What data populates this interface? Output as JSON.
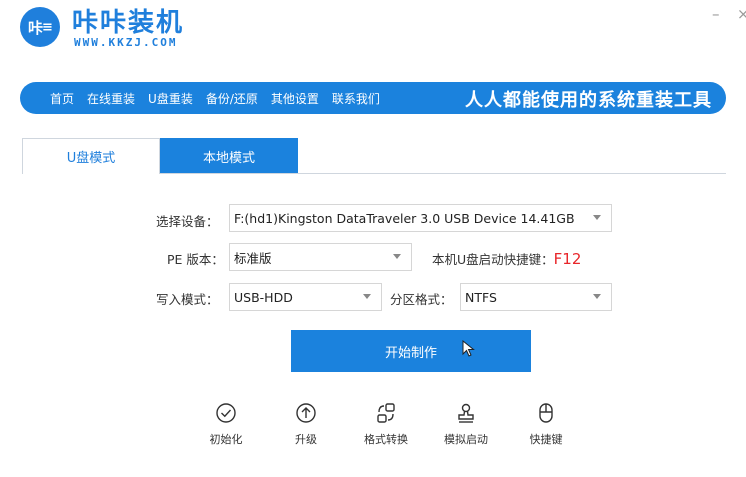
{
  "header": {
    "logo_text": "咔",
    "title": "咔咔装机",
    "url": "WWW.KKZJ.COM",
    "min_glyph": "–",
    "close_glyph": "×"
  },
  "nav": {
    "items": [
      {
        "label": "首页"
      },
      {
        "label": "在线重装"
      },
      {
        "label": "U盘重装"
      },
      {
        "label": "备份/还原"
      },
      {
        "label": "其他设置"
      },
      {
        "label": "联系我们"
      }
    ],
    "slogan": "人人都能使用的系统重装工具"
  },
  "tabs": [
    {
      "label": "U盘模式"
    },
    {
      "label": "本地模式"
    }
  ],
  "form": {
    "device_label": "选择设备：",
    "device_value": "F:(hd1)Kingston DataTraveler 3.0 USB Device 14.41GB",
    "pe_label": "PE 版本：",
    "pe_value": "标准版",
    "hotkey_label": "本机U盘启动快捷键：",
    "hotkey_value": "F12",
    "write_label": "写入模式：",
    "write_value": "USB-HDD",
    "partition_label": "分区格式：",
    "partition_value": "NTFS"
  },
  "start_button": {
    "label": "开始制作"
  },
  "tools": [
    {
      "label": "初始化",
      "icon": "check-circle-icon"
    },
    {
      "label": "升级",
      "icon": "arrow-up-circle-icon"
    },
    {
      "label": "格式转换",
      "icon": "convert-icon"
    },
    {
      "label": "模拟启动",
      "icon": "stamp-icon"
    },
    {
      "label": "快捷键",
      "icon": "mouse-icon"
    }
  ],
  "colors": {
    "accent": "#1b82dd",
    "hotkey": "#e8262a"
  }
}
